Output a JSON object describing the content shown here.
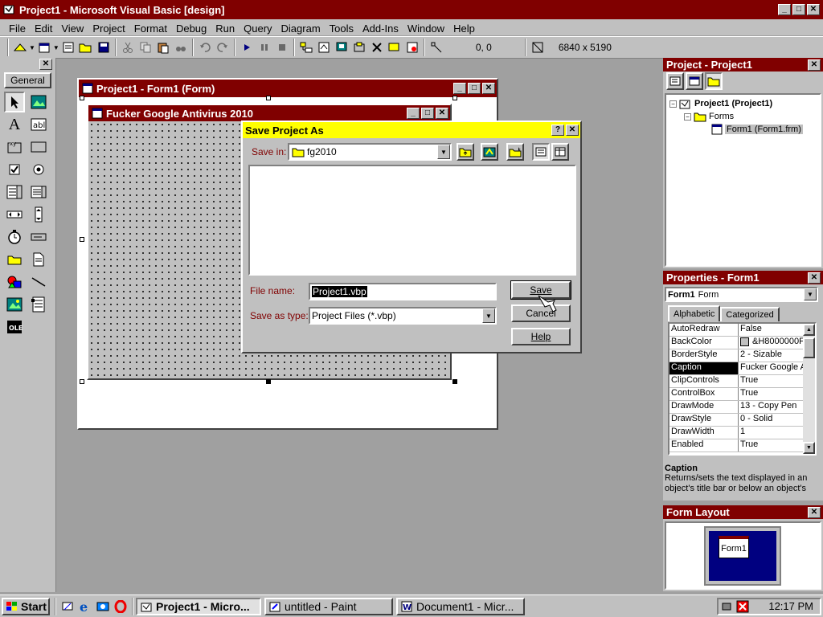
{
  "app": {
    "title": "Project1 - Microsoft Visual Basic [design]"
  },
  "menu": [
    "File",
    "Edit",
    "View",
    "Project",
    "Format",
    "Debug",
    "Run",
    "Query",
    "Diagram",
    "Tools",
    "Add-Ins",
    "Window",
    "Help"
  ],
  "toolbar": {
    "coords": "0, 0",
    "size": "6840 x 5190"
  },
  "toolbox": {
    "tab_label": "General"
  },
  "form_designer": {
    "title": "Project1 - Form1 (Form)",
    "form_caption": "Fucker Google Antivirus 2010"
  },
  "save_dialog": {
    "title": "Save Project As",
    "save_in_label": "Save in:",
    "save_in_value": "fg2010",
    "file_name_label": "File name:",
    "file_name_value": "Project1.vbp",
    "save_type_label": "Save as type:",
    "save_type_value": "Project Files (*.vbp)",
    "save_button": "Save",
    "cancel_button": "Cancel",
    "help_button": "Help"
  },
  "project_explorer": {
    "title": "Project - Project1",
    "root": "Project1 (Project1)",
    "folder": "Forms",
    "item": "Form1 (Form1.frm)"
  },
  "properties": {
    "title": "Properties - Form1",
    "object_name": "Form1",
    "object_type": "Form",
    "tab_alpha": "Alphabetic",
    "tab_cat": "Categorized",
    "rows": [
      {
        "name": "AutoRedraw",
        "value": "False"
      },
      {
        "name": "BackColor",
        "value": "&H8000000F"
      },
      {
        "name": "BorderStyle",
        "value": "2 - Sizable"
      },
      {
        "name": "Caption",
        "value": "Fucker Google A"
      },
      {
        "name": "ClipControls",
        "value": "True"
      },
      {
        "name": "ControlBox",
        "value": "True"
      },
      {
        "name": "DrawMode",
        "value": "13 - Copy Pen"
      },
      {
        "name": "DrawStyle",
        "value": "0 - Solid"
      },
      {
        "name": "DrawWidth",
        "value": "1"
      },
      {
        "name": "Enabled",
        "value": "True"
      }
    ],
    "desc_title": "Caption",
    "desc_text": "Returns/sets the text displayed in an object's title bar or below an object's"
  },
  "form_layout": {
    "title": "Form Layout",
    "form_label": "Form1"
  },
  "taskbar": {
    "start": "Start",
    "tasks": [
      "Project1 - Micro...",
      "untitled - Paint",
      "Document1 - Micr..."
    ],
    "clock": "12:17 PM"
  },
  "colors": {
    "title_active": "#800000",
    "dialog_title": "#ffff00",
    "face": "#c0c0c0",
    "workspace": "#a0a0a0"
  }
}
